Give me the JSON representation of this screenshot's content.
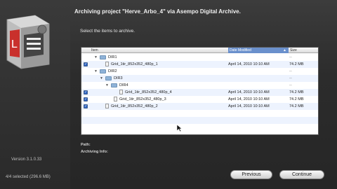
{
  "window": {
    "title": "Archiving project \"Herve_Arbo_4\" via Asempo Digital Archive.",
    "instruction": "Select the items to archive."
  },
  "left_panel": {
    "version": "Version 3.1.0.33",
    "selection_count": "4/4 selected (296.6 MB)"
  },
  "file_list": {
    "columns": {
      "item": "Item",
      "date": "Date Modified",
      "size": "Size"
    },
    "rows": [
      {
        "kind": "folder",
        "checked": false,
        "name": "DIR1",
        "date": "",
        "size": "--"
      },
      {
        "kind": "file",
        "checked": true,
        "name": "Grid_1tir_852x352_480p_1",
        "date": "April 14, 2010 10:10 AM",
        "size": "74.2 MB"
      },
      {
        "kind": "folder",
        "checked": false,
        "name": "DIR2",
        "date": "",
        "size": "--"
      },
      {
        "kind": "folder",
        "checked": false,
        "name": "DIR3",
        "date": "",
        "size": "--"
      },
      {
        "kind": "folder",
        "checked": false,
        "name": "DIR4",
        "date": "",
        "size": "--"
      },
      {
        "kind": "file",
        "checked": true,
        "name": "Grid_1tir_852x352_480p_4",
        "date": "April 14, 2010 10:10 AM",
        "size": "74.2 MB"
      },
      {
        "kind": "file",
        "checked": true,
        "name": "Grid_1tir_852x352_480p_3",
        "date": "April 14, 2010 10:10 AM",
        "size": "74.2 MB"
      },
      {
        "kind": "file",
        "checked": true,
        "name": "Grid_1tir_852x352_480p_2",
        "date": "April 14, 2010 10:10 AM",
        "size": "74.2 MB"
      }
    ]
  },
  "info": {
    "path_label": "Path:",
    "archiving_info_label": "Archiving Info:"
  },
  "buttons": {
    "previous": "Previous",
    "continue": "Continue"
  },
  "colors": {
    "sorted_header": "#6a90cc",
    "checkbox": "#2c63c4",
    "row_alt": "#edf3fe"
  }
}
